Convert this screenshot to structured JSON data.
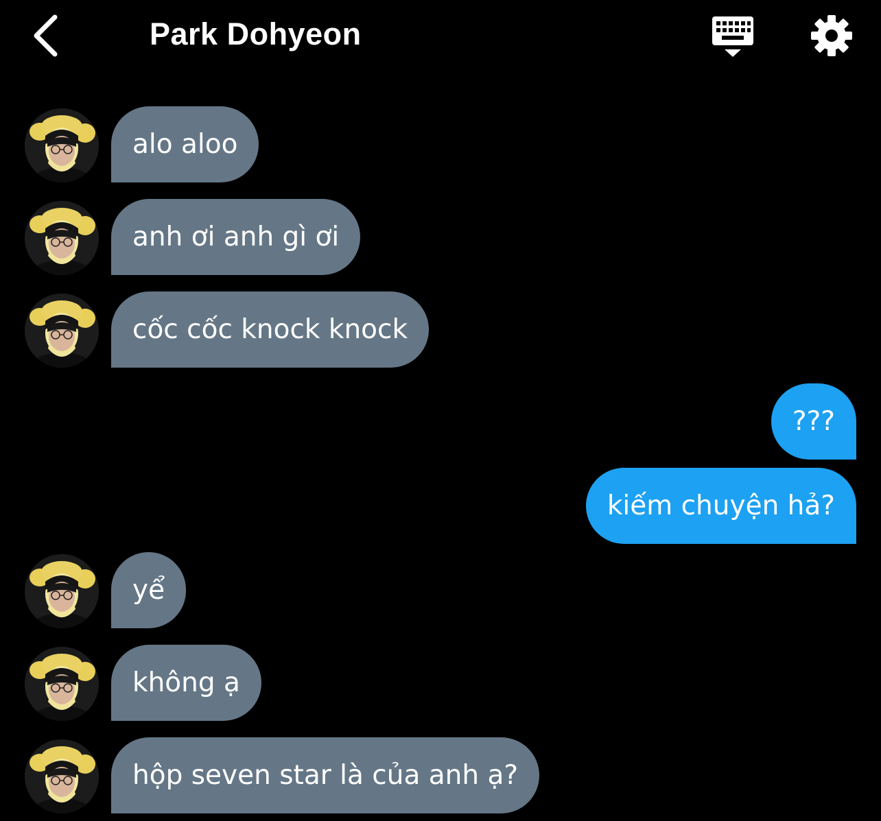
{
  "header": {
    "title": "Park Dohyeon",
    "back_icon": "chevron-left-icon",
    "keyboard_icon": "keyboard-hide-icon",
    "settings_icon": "gear-icon"
  },
  "messages": [
    {
      "side": "in",
      "text": "alo aloo"
    },
    {
      "side": "in",
      "text": "anh ơi anh gì ơi"
    },
    {
      "side": "in",
      "text": "cốc cốc knock knock"
    },
    {
      "side": "out",
      "text": "???"
    },
    {
      "side": "out",
      "text": "kiếm chuyện hả?"
    },
    {
      "side": "in",
      "text": "yể"
    },
    {
      "side": "in",
      "text": "không ạ"
    },
    {
      "side": "in",
      "text": "hộp seven star là của anh ạ?"
    }
  ],
  "colors": {
    "background": "#000000",
    "incoming_bubble": "#657786",
    "outgoing_bubble": "#1da1f2",
    "text": "#ffffff"
  }
}
